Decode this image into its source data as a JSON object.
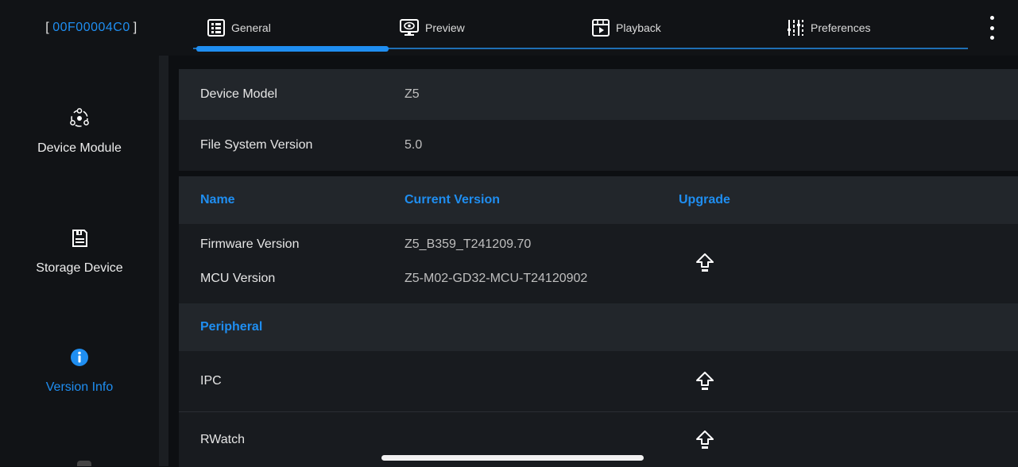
{
  "header": {
    "device_id_open": "[",
    "device_id": "00F00004C0",
    "device_id_close": "]",
    "tabs": [
      {
        "label": "General",
        "icon": "general-icon",
        "active": true
      },
      {
        "label": "Preview",
        "icon": "preview-icon",
        "active": false
      },
      {
        "label": "Playback",
        "icon": "playback-icon",
        "active": false
      },
      {
        "label": "Preferences",
        "icon": "preferences-icon",
        "active": false
      }
    ],
    "more_icon": "more-vertical-icon"
  },
  "sidebar": {
    "items": [
      {
        "label": "Device Module",
        "icon": "device-module-icon",
        "active": false
      },
      {
        "label": "Storage Device",
        "icon": "storage-device-icon",
        "active": false
      },
      {
        "label": "Version Info",
        "icon": "info-icon",
        "active": true
      }
    ]
  },
  "main": {
    "device_model_label": "Device Model",
    "device_model_value": "Z5",
    "fs_version_label": "File System Version",
    "fs_version_value": "5.0",
    "table_headers": {
      "name": "Name",
      "current_version": "Current Version",
      "upgrade": "Upgrade"
    },
    "firmware_label": "Firmware Version",
    "firmware_value": "Z5_B359_T241209.70",
    "mcu_label": "MCU Version",
    "mcu_value": "Z5-M02-GD32-MCU-T24120902",
    "peripheral_header": "Peripheral",
    "peripherals": [
      {
        "label": "IPC"
      },
      {
        "label": "RWatch"
      }
    ],
    "upgrade_icon": "upload-arrow-icon"
  },
  "colors": {
    "accent": "#1f8ef1",
    "background": "#0d0f12",
    "row_shade": "#22262b"
  }
}
